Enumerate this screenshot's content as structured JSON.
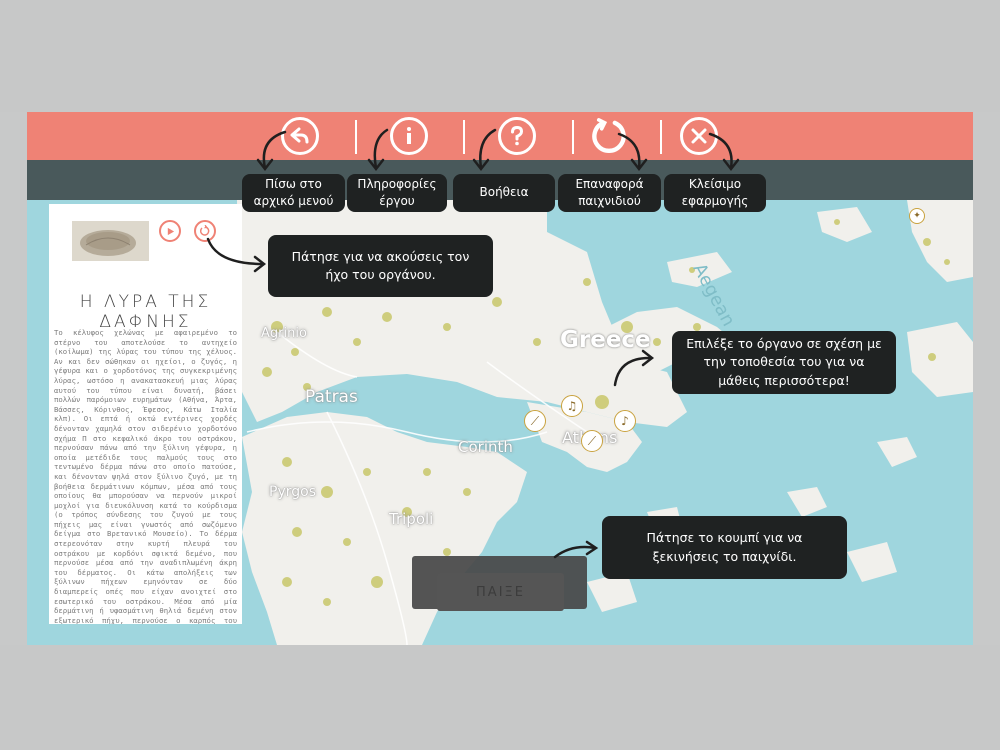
{
  "toolbar": {
    "back": {
      "icon": "back-arrow-icon",
      "label": "Πίσω στο αρχικό μενού"
    },
    "info": {
      "icon": "info-icon",
      "label": "Πληροφορίες έργου"
    },
    "help": {
      "icon": "question-icon",
      "label": "Βοήθεια"
    },
    "reset": {
      "icon": "reload-icon",
      "label": "Επαναφορά παιχνιδιού"
    },
    "close": {
      "icon": "close-icon",
      "label": "Κλείσιμο εφαρμογής"
    }
  },
  "panel": {
    "title": "Η ΛΥΡΑ ΤΗΣ ΔΑΦΝΗΣ",
    "description": "Το κέλυφος χελώνας με αφαιρεμένο το στέρνο του αποτελούσε το αντηχείο (κοίλωμα) της λύρας του τύπου της χέλυος. Αν και δεν σώθηκαν οι ηχείοι, ο ζυγός, η γέφυρα και ο χορδοτόνος της συγκεκριμένης λύρας, ωστόσο η ανακατασκευή μιας λύρας αυτού του τύπου είναι δυνατή, βάσει πολλών παρόμοιων ευρημάτων (Αθήνα, Άρτα, Βάσσες, Κόρινθος, Έφεσος, Κάτω Ιταλία κλπ). Οι επτά ή οκτώ εντέρινες χορδές δένονταν χαμηλά στον σιδερένιο χορδοτόνο σχήμα Π στο κεφαλικό άκρο του οστράκου, περνούσαν πάνω από την ξύλινη γέφυρα, η οποία μετέδιδε τους παλμούς τους στο τεντωμένο δέρμα πάνω στο οποίο πατούσε, και δένονταν ψηλά στον ξύλινο ζυγό, με τη βοήθεια δερμάτινων κόμπων, μέσα από τους οποίους θα μπορούσαν να περνούν μικροί μοχλοί για διευκόλυνση κατά το κούρδισμα (ο τρόπος σύνδεσης του ζυγού με τους πήχεις μας είναι γνωστός από σωζόμενο δείγμα στο Βρετανικό Μουσείο). Το δέρμα στερεονόταν στην κυρτή πλευρά του οστράκου με κορδόνι σφικτά δεμένο, που περνούσε μέσα από την αναδιπλωμένη άκρη του δέρματος. Οι κάτω απολήξεις των ξύλινων πήχεων εμηνόνταν σε δύο διαμπερείς οπές που είχαν ανοιχτεί στο εσωτερικό του οστράκου. Μέσα από μία δερμάτινη ή υφασμάτινη θηλιά δεμένη στον εξωτερικό πήχυ, περνούσε ο καρπός του αριστερού χεριού, προκειμένου, αφενός μεν να στηριχτεί το όργανο πάνω στον αριστερό γοφό του λυριστή, αφετέρου δε να μπορούν τα δάχτυλα να επεμβαίνουν στις χορδές. Στο δεξί του χέρι ο λυριστής κρατούσε μακρύ πλήκτρο, από ξύλο ή άλλο υλικό, δεμένο με κορδόνι στον εξωτερικό πήχυ για να μην χάνεται, με το οποίο σάρωνε τις χορδές, παράγοντας αρπίσματα, ή έκρουε μεμονωμένες χορδές",
    "play_icon": "play-icon",
    "replay_icon": "replay-icon"
  },
  "tooltips": {
    "sound": "Πάτησε για να ακούσεις τον ήχο του οργάνου.",
    "instrument": "Επιλέξε το όργανο σε σχέση με την τοποθεσία του για να μάθεις περισσότερα!",
    "play": "Πάτησε το κουμπί για να ξεκινήσεις το παιχνίδι."
  },
  "map": {
    "labels": {
      "greece": "Greece",
      "aegean": "Aegean",
      "agrinio": "Agrinio",
      "patras": "Patras",
      "corinth": "Corinth",
      "athens": "Athens",
      "pyrgos": "Pyrgos",
      "tripoli": "Tripoli"
    }
  },
  "play_button": {
    "label": "ΠΑΙΞΕ"
  },
  "colors": {
    "accent": "#ef8275",
    "tooltip_bg": "#1f2222",
    "sea": "#9fd6de",
    "land": "#f1f0ec",
    "forest": "#c9c76a"
  }
}
